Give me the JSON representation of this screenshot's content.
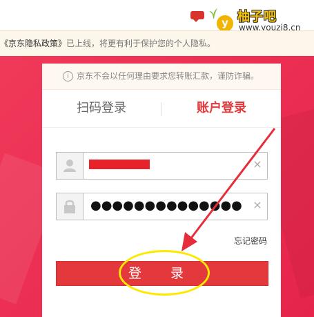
{
  "notice": {
    "lead": "《京东隐私政策》",
    "tail": "已上线，将更有利于保护您的个人隐私。"
  },
  "watermark": {
    "badge": "y",
    "title": "柚子吧",
    "url": "www.youzi8.cn"
  },
  "safety": {
    "info_icon": "i",
    "text": "京东不会以任何理由要求您转账汇款，谨防诈骗。"
  },
  "tabs": [
    {
      "label": "扫码登录"
    },
    {
      "label": "账户登录"
    }
  ],
  "form": {
    "password_mask": "●●●●●●●●●●●●●●",
    "clear_icon": "×",
    "forgot": "忘记密码",
    "login": "登 录"
  },
  "colors": {
    "accent": "#e4393c",
    "hero": "#e6244a",
    "annotation_arrow": "#e62e3a",
    "annotation_circle": "#ffe800"
  }
}
